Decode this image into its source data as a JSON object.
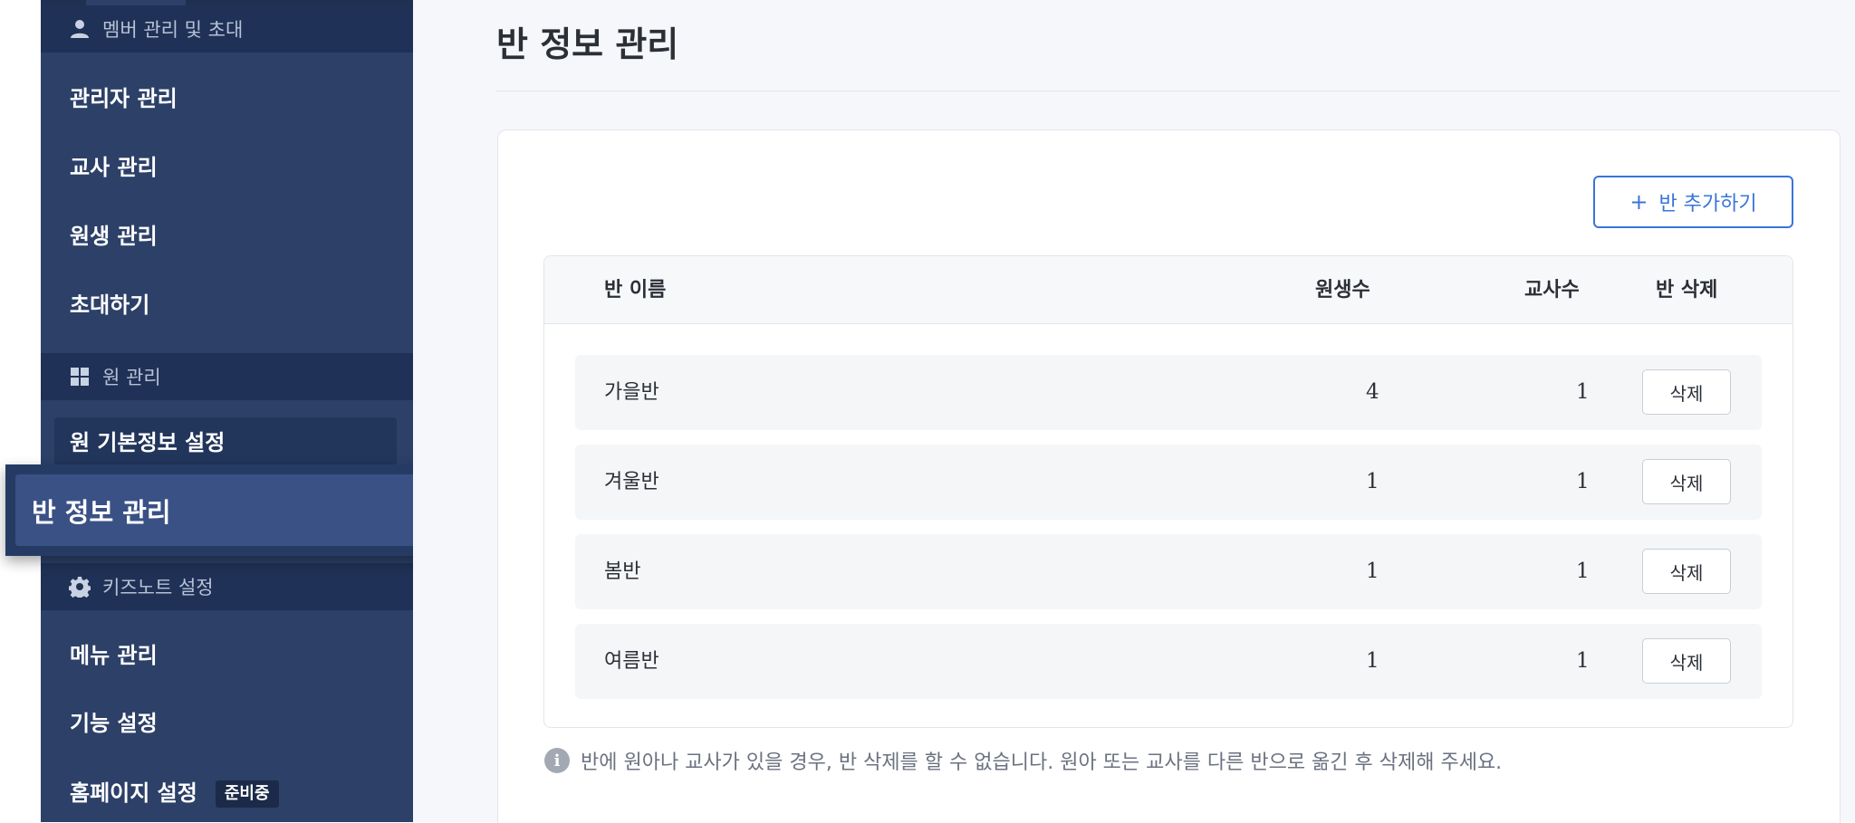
{
  "sidebar": {
    "sections": [
      {
        "label": "멤버 관리 및 초대",
        "icon": "person-icon"
      },
      {
        "label": "원 관리",
        "icon": "grid-icon"
      },
      {
        "label": "키즈노트 설정",
        "icon": "gear-icon"
      }
    ],
    "member_items": [
      "관리자 관리",
      "교사 관리",
      "원생 관리",
      "초대하기"
    ],
    "school_items": [
      "원 기본정보 설정",
      "반 정보 관리"
    ],
    "settings_items": [
      "메뉴 관리",
      "기능 설정",
      "홈페이지 설정"
    ],
    "homepage_badge": "준비중"
  },
  "page": {
    "title": "반 정보 관리",
    "add_button": "반 추가하기"
  },
  "table": {
    "headers": [
      "반 이름",
      "원생수",
      "교사수",
      "반 삭제"
    ],
    "rows": [
      {
        "name": "가을반",
        "students": "4",
        "teachers": "1",
        "action": "삭제"
      },
      {
        "name": "겨울반",
        "students": "1",
        "teachers": "1",
        "action": "삭제"
      },
      {
        "name": "봄반",
        "students": "1",
        "teachers": "1",
        "action": "삭제"
      },
      {
        "name": "여름반",
        "students": "1",
        "teachers": "1",
        "action": "삭제"
      }
    ]
  },
  "notice": "반에 원아나 교사가 있을 경우, 반 삭제를 할 수 없습니다. 원아 또는 교사를 다른 반으로 옮긴 후 삭제해 주세요.",
  "colors": {
    "sidebar_bg": "#2c4068",
    "section_bg": "#1f3156",
    "accent": "#3b74d8"
  }
}
